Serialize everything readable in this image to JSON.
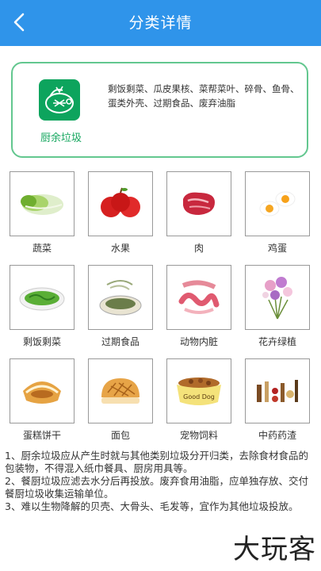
{
  "header": {
    "title": "分类详情",
    "back_icon": "chevron-left-icon"
  },
  "category": {
    "name": "厨余垃圾",
    "description": "剩饭剩菜、瓜皮果核、菜帮菜叶、碎骨、鱼骨、蛋类外壳、过期食品、废弃油脂",
    "icon": "food-waste-icon",
    "accent": "#0da45d"
  },
  "items": [
    {
      "label": "蔬菜",
      "icon": "cabbage-icon"
    },
    {
      "label": "水果",
      "icon": "apple-icon"
    },
    {
      "label": "肉",
      "icon": "meat-icon"
    },
    {
      "label": "鸡蛋",
      "icon": "egg-icon"
    },
    {
      "label": "剩饭剩菜",
      "icon": "leftovers-icon"
    },
    {
      "label": "过期食品",
      "icon": "expired-food-icon"
    },
    {
      "label": "动物内脏",
      "icon": "offal-icon"
    },
    {
      "label": "花卉绿植",
      "icon": "flowers-icon"
    },
    {
      "label": "蛋糕饼干",
      "icon": "cake-icon"
    },
    {
      "label": "面包",
      "icon": "bread-icon"
    },
    {
      "label": "宠物饲料",
      "icon": "pet-food-icon",
      "badge": "Good Dog"
    },
    {
      "label": "中药药渣",
      "icon": "herbs-icon"
    }
  ],
  "notes": [
    "1、厨余垃圾应从产生时就与其他类别垃圾分开归类，去除食材食品的包装物，不得混入纸巾餐具、厨房用具等。",
    "2、餐厨垃圾应滤去水分后再投放。废弃食用油脂，应单独存放、交付餐厨垃圾收集运输单位。",
    "3、难以生物降解的贝壳、大骨头、毛发等，宜作为其他垃圾投放。"
  ],
  "watermark": "大玩客"
}
